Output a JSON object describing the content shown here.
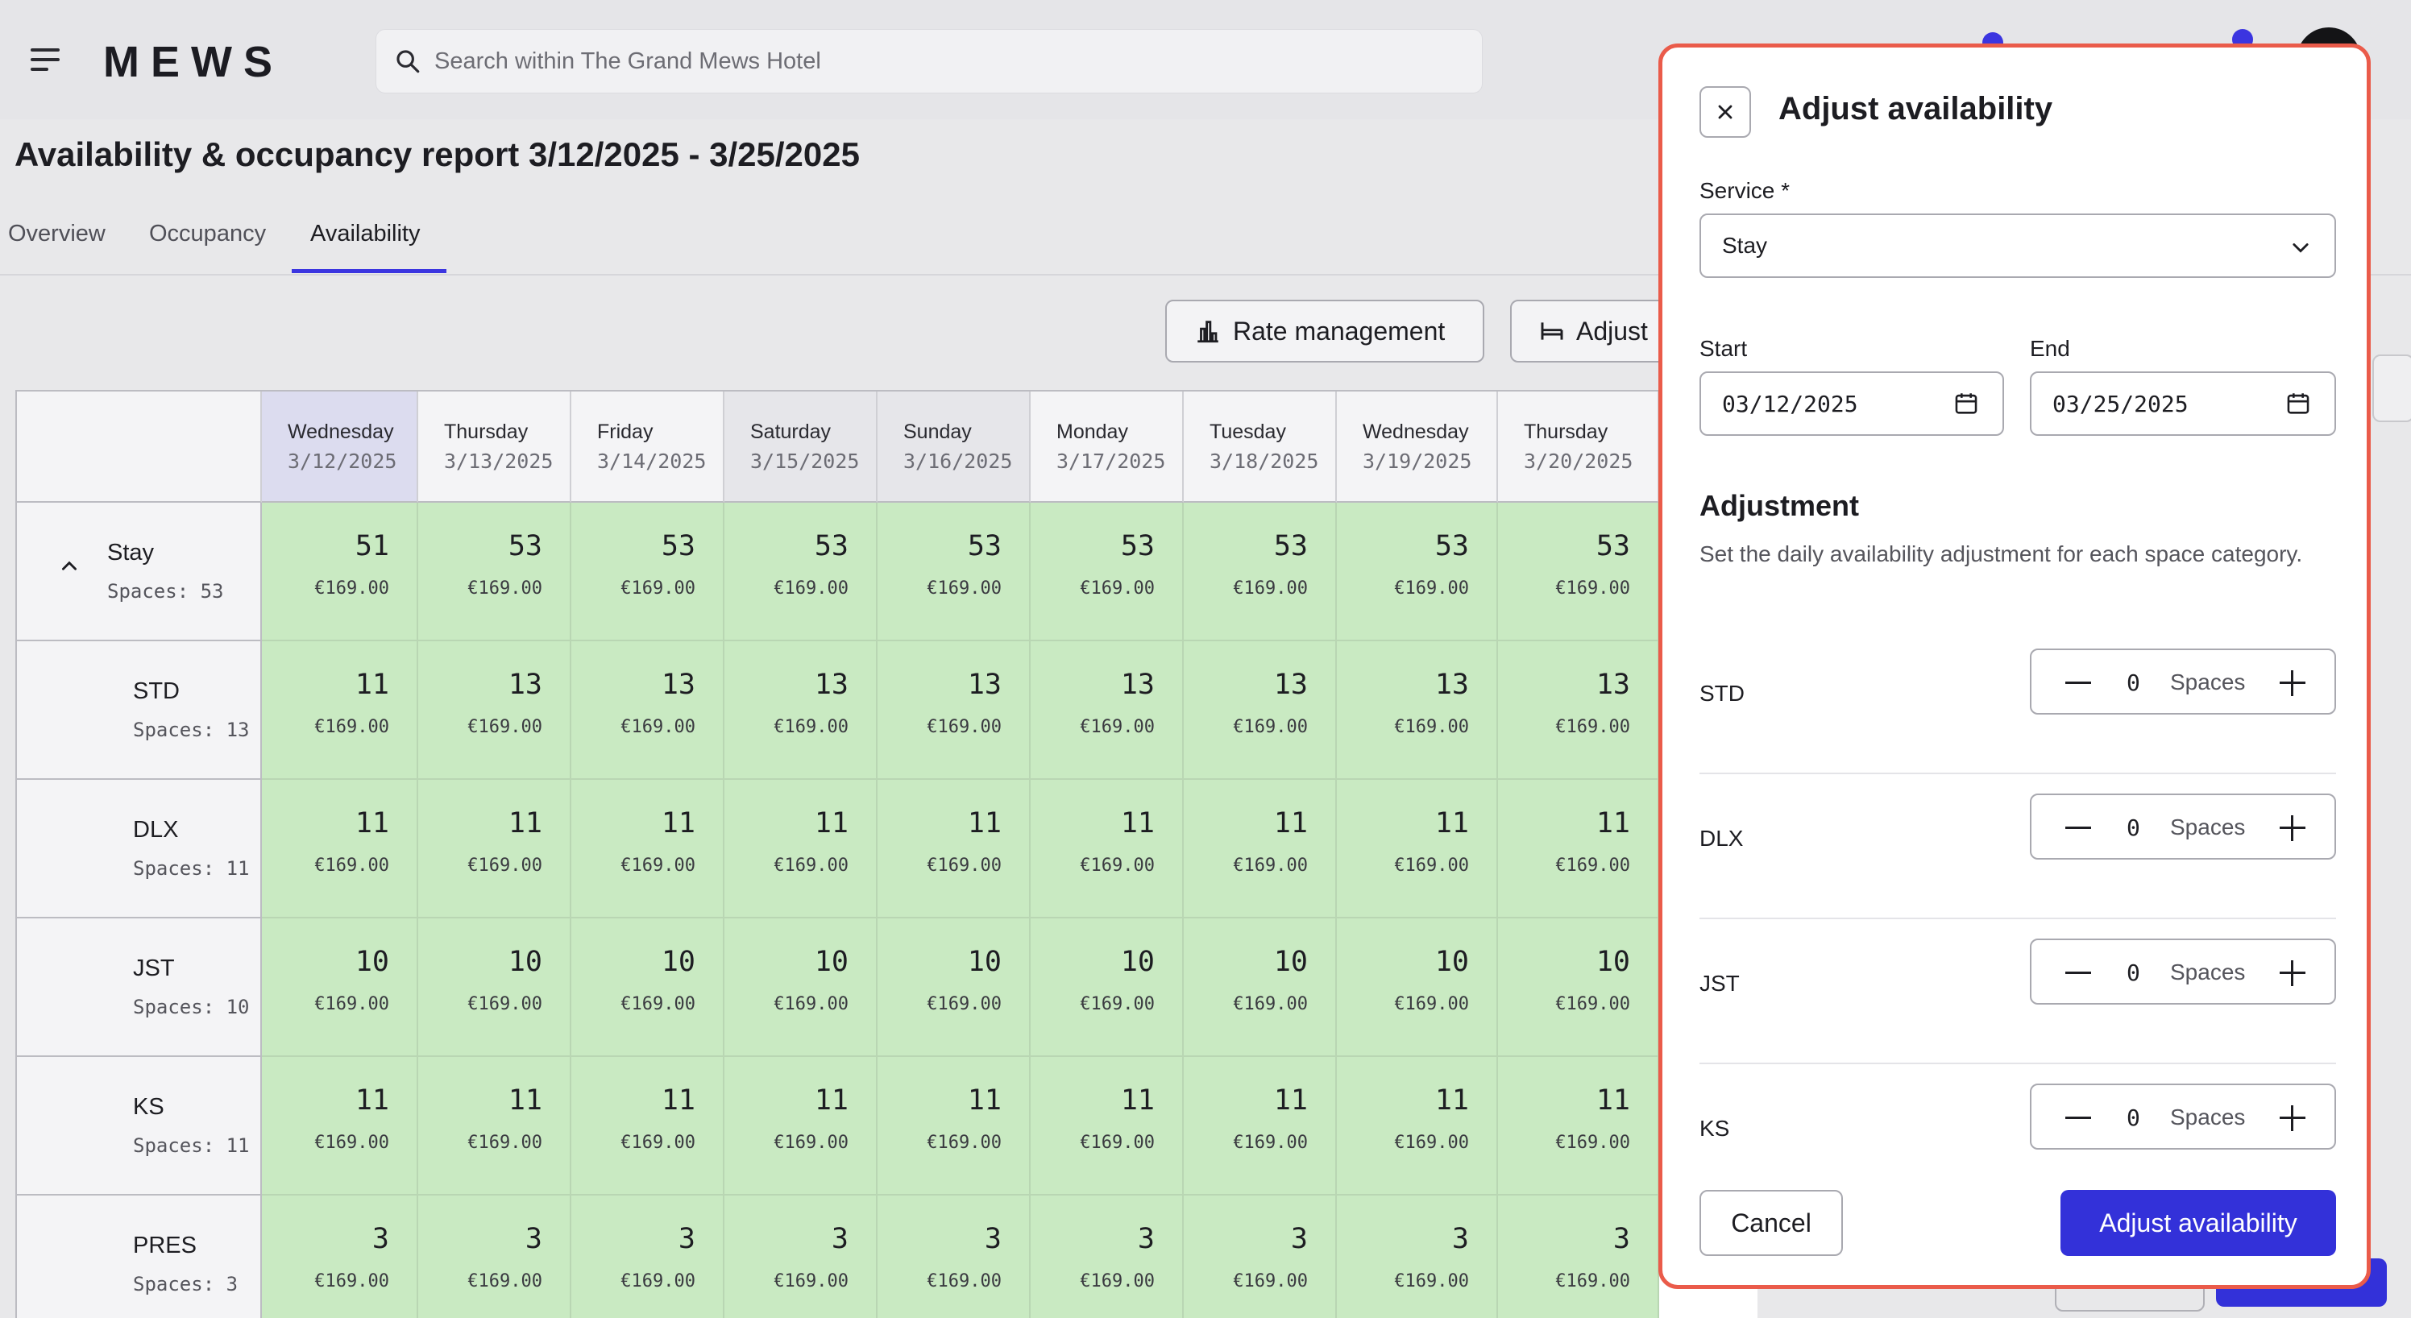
{
  "header": {
    "logo": "MEWS",
    "search_placeholder": "Search within The Grand Mews Hotel"
  },
  "page": {
    "title": "Availability & occupancy report 3/12/2025 - 3/25/2025",
    "tabs": [
      {
        "label": "Overview"
      },
      {
        "label": "Occupancy"
      },
      {
        "label": "Availability"
      }
    ],
    "active_tab": "Availability",
    "actions": {
      "rate_management": "Rate management",
      "adjust": "Adjust"
    }
  },
  "table": {
    "columns": [
      {
        "day": "Wednesday",
        "date": "3/12/2025"
      },
      {
        "day": "Thursday",
        "date": "3/13/2025"
      },
      {
        "day": "Friday",
        "date": "3/14/2025"
      },
      {
        "day": "Saturday",
        "date": "3/15/2025"
      },
      {
        "day": "Sunday",
        "date": "3/16/2025"
      },
      {
        "day": "Monday",
        "date": "3/17/2025"
      },
      {
        "day": "Tuesday",
        "date": "3/18/2025"
      },
      {
        "day": "Wednesday",
        "date": "3/19/2025"
      },
      {
        "day": "Thursday",
        "date": "3/20/2025"
      }
    ],
    "rows": [
      {
        "name": "Stay",
        "spaces": "Spaces: 53",
        "values": [
          "51",
          "53",
          "53",
          "53",
          "53",
          "53",
          "53",
          "53",
          "53"
        ],
        "price": "€169.00"
      },
      {
        "name": "STD",
        "spaces": "Spaces: 13",
        "values": [
          "11",
          "13",
          "13",
          "13",
          "13",
          "13",
          "13",
          "13",
          "13"
        ],
        "price": "€169.00"
      },
      {
        "name": "DLX",
        "spaces": "Spaces: 11",
        "values": [
          "11",
          "11",
          "11",
          "11",
          "11",
          "11",
          "11",
          "11",
          "11"
        ],
        "price": "€169.00"
      },
      {
        "name": "JST",
        "spaces": "Spaces: 10",
        "values": [
          "10",
          "10",
          "10",
          "10",
          "10",
          "10",
          "10",
          "10",
          "10"
        ],
        "price": "€169.00"
      },
      {
        "name": "KS",
        "spaces": "Spaces: 11",
        "values": [
          "11",
          "11",
          "11",
          "11",
          "11",
          "11",
          "11",
          "11",
          "11"
        ],
        "price": "€169.00"
      },
      {
        "name": "PRES",
        "spaces": "Spaces: 3",
        "values": [
          "3",
          "3",
          "3",
          "3",
          "3",
          "3",
          "3",
          "3",
          "3"
        ],
        "price": "€169.00"
      }
    ]
  },
  "modal": {
    "title": "Adjust availability",
    "service_label": "Service *",
    "service_value": "Stay",
    "start_label": "Start",
    "start_value": "03/12/2025",
    "end_label": "End",
    "end_value": "03/25/2025",
    "adjustment_title": "Adjustment",
    "adjustment_desc": "Set the daily availability adjustment for each space category.",
    "categories": [
      {
        "code": "STD",
        "value": "0",
        "unit": "Spaces"
      },
      {
        "code": "DLX",
        "value": "0",
        "unit": "Spaces"
      },
      {
        "code": "JST",
        "value": "0",
        "unit": "Spaces"
      },
      {
        "code": "KS",
        "value": "0",
        "unit": "Spaces"
      }
    ],
    "cancel_label": "Cancel",
    "submit_label": "Adjust availability"
  },
  "colors": {
    "accent": "#3331d9",
    "modal_border": "#ea5b4a",
    "cell_green": "#c9eac2"
  }
}
